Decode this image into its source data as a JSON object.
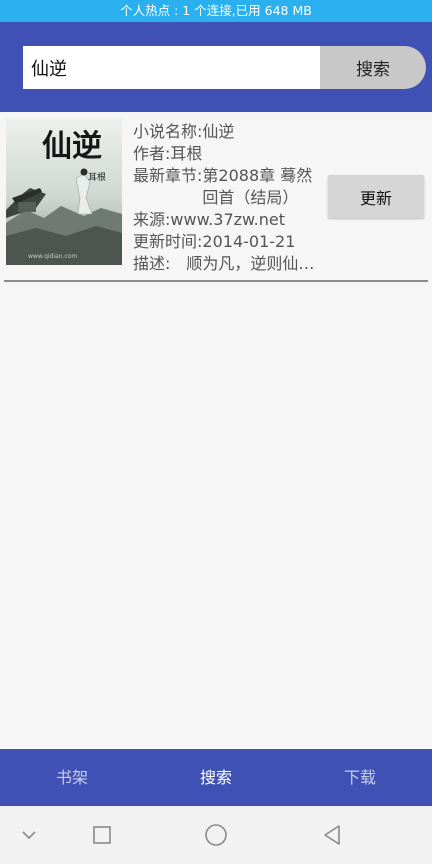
{
  "status_bar": {
    "text": "个人热点 : 1 个连接,已用 648 MB"
  },
  "search": {
    "value": "仙逆",
    "button_label": "搜索"
  },
  "result": {
    "title_label": "小说名称:",
    "title_value": "仙逆",
    "author_label": "作者:",
    "author_value": "耳根",
    "chapter_label": "最新章节:",
    "chapter_value": "第2088章 蓦然回首（结局）",
    "source_label": "来源:",
    "source_value": "www.37zw.net",
    "updated_label": "更新时间:",
    "updated_value": "2014-01-21",
    "desc_label": "描述:",
    "desc_value": "　顺为凡，逆则仙…",
    "update_button_label": "更新",
    "cover": {
      "title_chars": "仙逆",
      "author_chars": "耳根",
      "watermark": "www.qidian.com"
    }
  },
  "bottom_nav": {
    "tabs": [
      {
        "label": "书架"
      },
      {
        "label": "搜索"
      },
      {
        "label": "下载"
      }
    ],
    "active_index": 1
  },
  "system_nav": {
    "icons": [
      "chevron-down-icon",
      "square-icon",
      "circle-icon",
      "triangle-back-icon"
    ]
  },
  "colors": {
    "status_bar": "#2bb0ef",
    "primary": "#3f51b5",
    "background": "#f6f6f6"
  }
}
